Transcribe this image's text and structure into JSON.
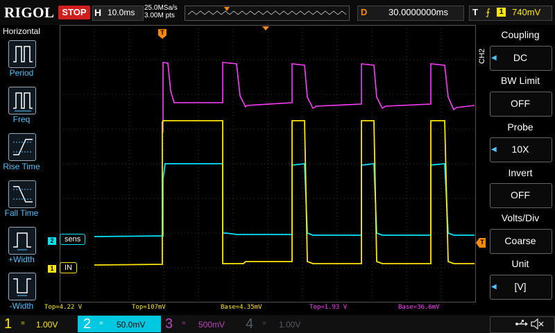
{
  "header": {
    "logo": "RIGOL",
    "run_status": "STOP",
    "timebase_letter": "H",
    "timebase": "10.0ms",
    "sample_rate": "25.0MSa/s",
    "memory_depth": "3.00M pts",
    "delay_letter": "D",
    "delay": "30.0000000ms",
    "trigger_letter": "T",
    "trigger_edge": "⨍",
    "trigger_source": "1",
    "trigger_level": "740mV"
  },
  "left_menu": {
    "title": "Horizontal",
    "items": [
      {
        "label": "Period",
        "icon": "period-icon"
      },
      {
        "label": "Freq",
        "icon": "frequency-icon"
      },
      {
        "label": "Rise Time",
        "icon": "rise-time-icon"
      },
      {
        "label": "Fall Time",
        "icon": "fall-time-icon"
      },
      {
        "label": "+Width",
        "icon": "positive-width-icon"
      },
      {
        "label": "-Width",
        "icon": "negative-width-icon"
      }
    ]
  },
  "right_menu": {
    "channel": "CH2",
    "items": [
      {
        "title": "Coupling",
        "value": "DC"
      },
      {
        "title": "BW Limit",
        "value": "OFF"
      },
      {
        "title": "Probe",
        "value": "10X"
      },
      {
        "title": "Invert",
        "value": "OFF"
      },
      {
        "title": "Volts/Div",
        "value": "Coarse"
      },
      {
        "title": "Unit",
        "value": "[V]"
      }
    ]
  },
  "traces": {
    "ch1_label": "IN",
    "ch2_label": "sens",
    "ch1_badge": "1",
    "ch2_badge": "2",
    "trigger_marker": "T"
  },
  "measurements": [
    {
      "text": "Top=4.22 V",
      "color": "#ffe800"
    },
    {
      "text": "Top=107mV",
      "color": "#ffe800"
    },
    {
      "text": "Base=4.35mV",
      "color": "#ffe800"
    },
    {
      "text": "Top=1.93 V",
      "color": "#ff3cff"
    },
    {
      "text": "Base=36.6mV",
      "color": "#ff3cff"
    }
  ],
  "channels": [
    {
      "num": "1",
      "coupling": "=",
      "scale": "1.00V",
      "color": "#ffe800"
    },
    {
      "num": "2",
      "coupling": "=",
      "scale": "50.0mV",
      "color": "#00e5ff"
    },
    {
      "num": "3",
      "coupling": "=",
      "scale": "500mV",
      "color": "#c040c0"
    },
    {
      "num": "4",
      "coupling": "=",
      "scale": "1.00V",
      "color": "#555a66"
    }
  ],
  "colors": {
    "ch1": "#ffe800",
    "ch2": "#00e5ff",
    "ch3": "#ff3cff",
    "accent": "#ff8a00",
    "menu_text": "#4fc3ff"
  }
}
